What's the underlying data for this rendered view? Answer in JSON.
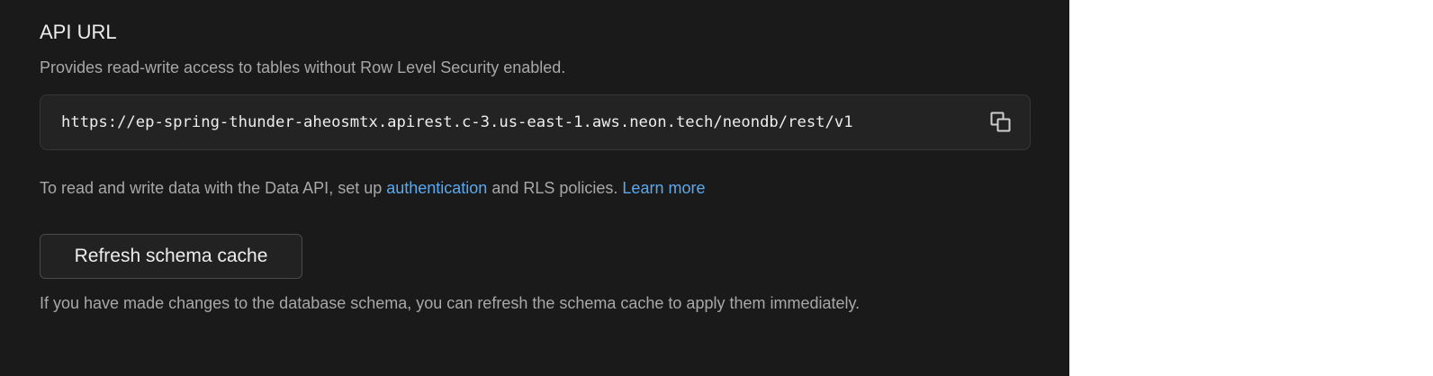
{
  "section": {
    "title": "API URL",
    "description": "Provides read-write access to tables without Row Level Security enabled."
  },
  "api_url": {
    "value": "https://ep-spring-thunder-aheosmtx.apirest.c-3.us-east-1.aws.neon.tech/neondb/rest/v1",
    "copy_icon": "copy-icon"
  },
  "info": {
    "prefix": "To read and write data with the Data API, set up ",
    "auth_link": "authentication",
    "middle": " and RLS policies. ",
    "learn_more_link": "Learn more"
  },
  "refresh": {
    "button_label": "Refresh schema cache",
    "help_text": "If you have made changes to the database schema, you can refresh the schema cache to apply them immediately."
  },
  "colors": {
    "background": "#1a1a1a",
    "link": "#5aa9f0",
    "text_primary": "#ededed",
    "text_secondary": "#a8a8a8"
  }
}
